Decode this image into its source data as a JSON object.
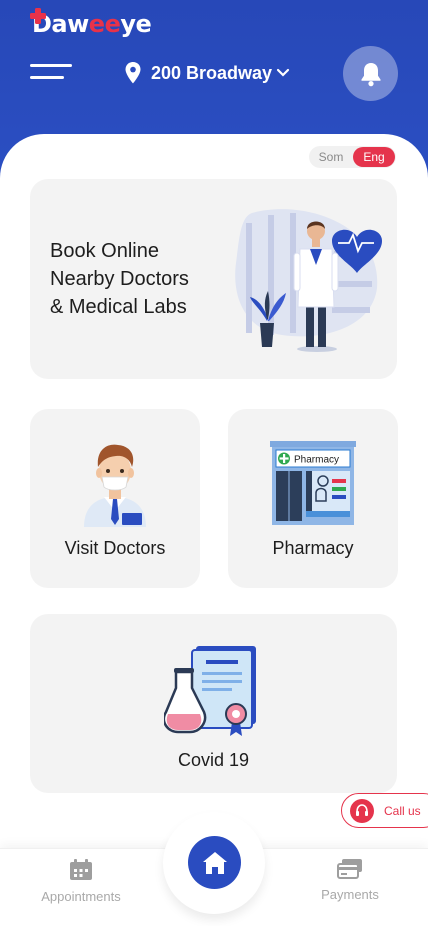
{
  "header": {
    "logo_prefix": "Daw",
    "logo_accent": "ee",
    "logo_suffix": "ye",
    "location": "200 Broadway"
  },
  "language": {
    "option_1": "Som",
    "option_2": "Eng",
    "selected": "Eng"
  },
  "cards": {
    "book_online_line1": "Book Online",
    "book_online_line2": "Nearby Doctors",
    "book_online_line3": "& Medical Labs",
    "visit_doctors": "Visit Doctors",
    "pharmacy": "Pharmacy",
    "pharmacy_sign": "Pharmacy",
    "covid": "Covid 19"
  },
  "call_us": "Call us",
  "bottom_nav": {
    "appointments": "Appointments",
    "payments": "Payments"
  },
  "icons": [
    "logo-plus-icon",
    "menu-icon",
    "location-pin-icon",
    "chevron-down-icon",
    "bell-icon",
    "headset-icon",
    "calendar-icon",
    "home-icon",
    "payments-icon"
  ],
  "colors": {
    "brand_blue": "#2a4cc0",
    "accent_red": "#e5344c",
    "card_bg": "#f3f3f3"
  }
}
